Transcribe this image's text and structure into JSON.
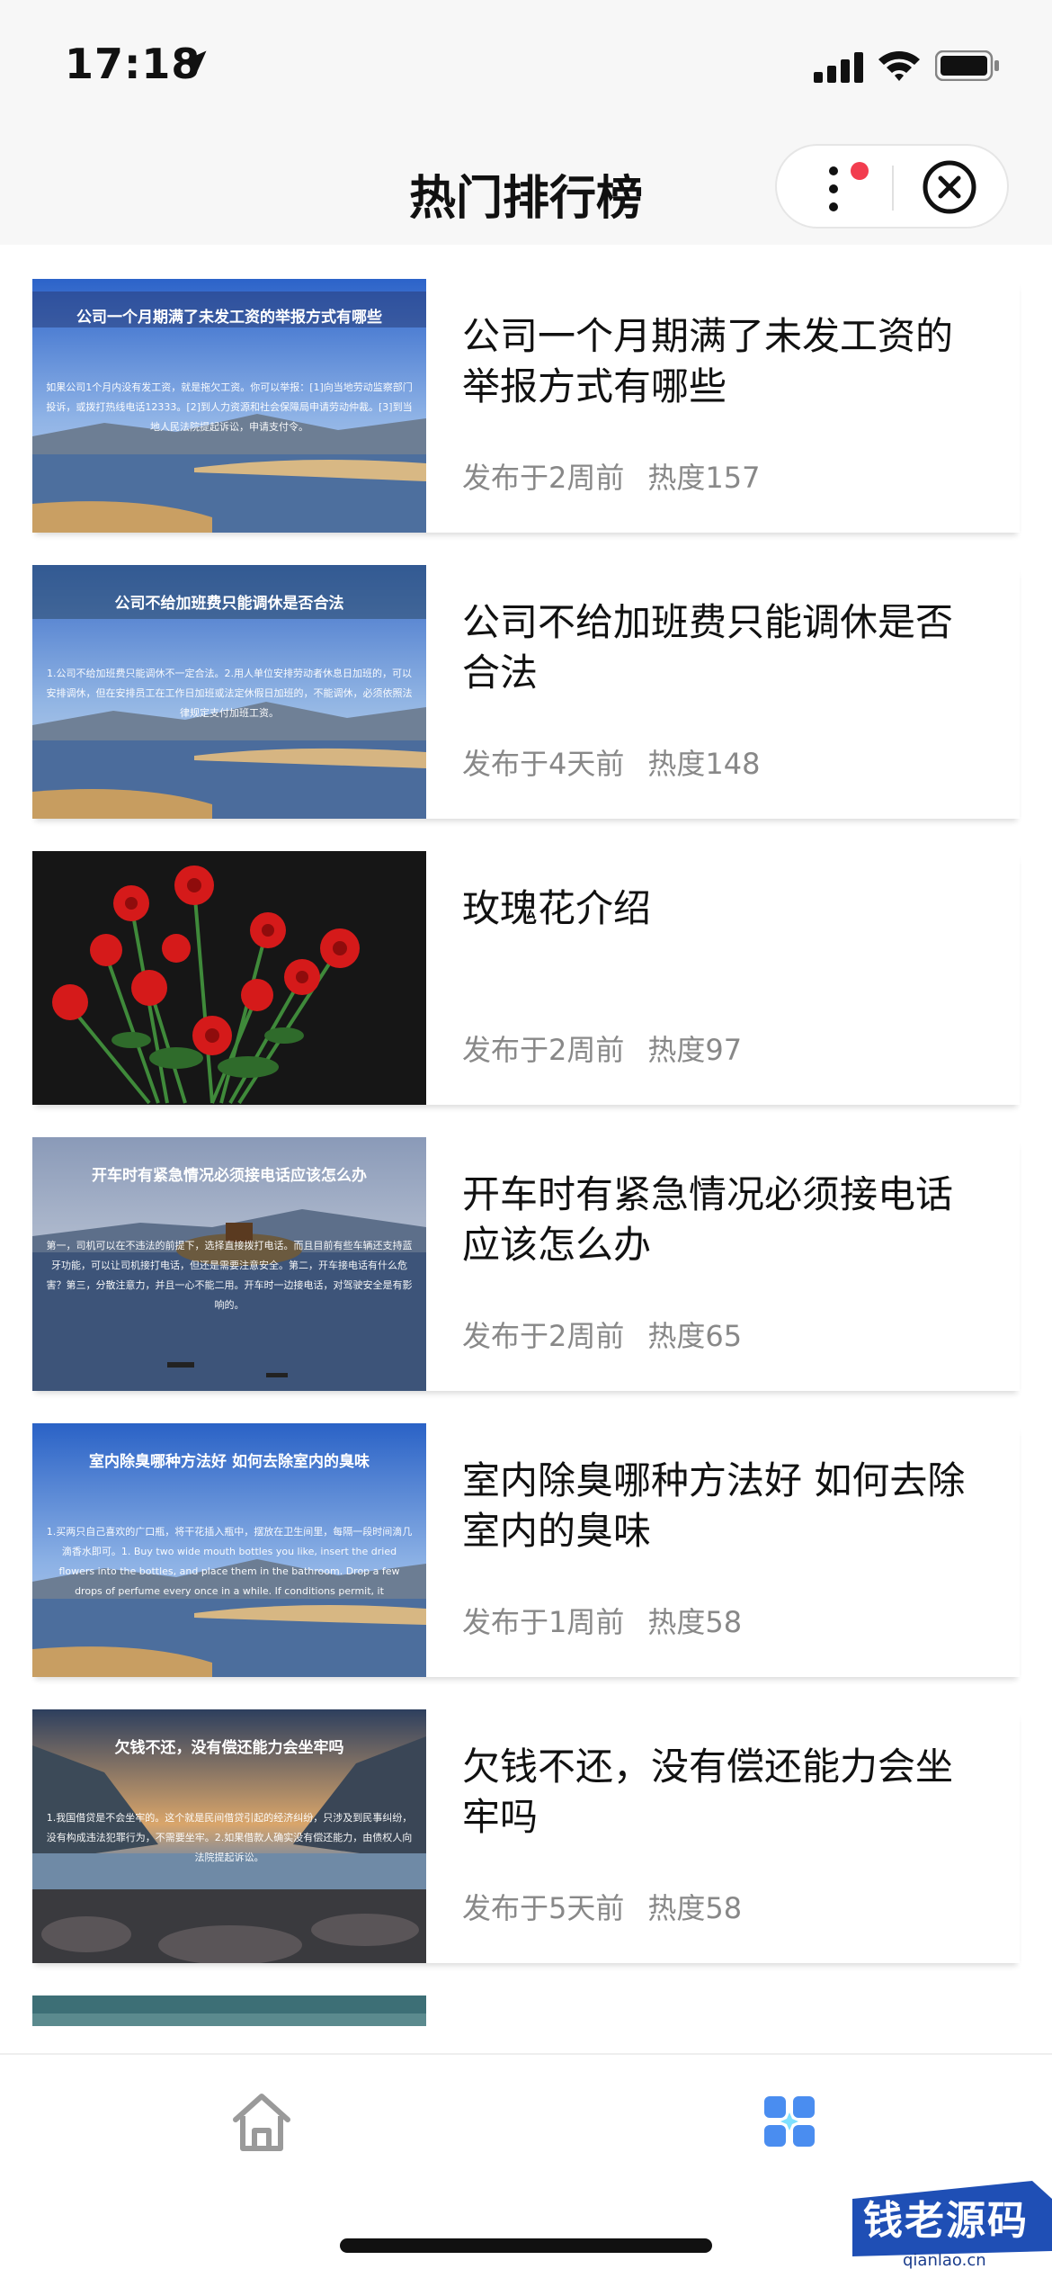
{
  "status_bar": {
    "time": "17:18"
  },
  "nav": {
    "title": "热门排行榜"
  },
  "items": [
    {
      "thumb_caption": "公司一个月期满了未发工资的举报方式有哪些",
      "thumb_body": "如果公司1个月内没有发工资，就是拖欠工资。你可以举报：[1]向当地劳动监察部门投诉，或拨打热线电话12333。[2]到人力资源和社会保障局申请劳动仲裁。[3]到当地人民法院提起诉讼，申请支付令。",
      "title": "公司一个月期满了未发工资的举报方式有哪些",
      "published": "发布于2周前",
      "heat": "热度157"
    },
    {
      "thumb_caption": "公司不给加班费只能调休是否合法",
      "thumb_body": "1.公司不给加班费只能调休不一定合法。2.用人单位安排劳动者休息日加班的，可以安排调休，但在安排员工在工作日加班或法定休假日加班的，不能调休，必须依照法律规定支付加班工资。",
      "title": "公司不给加班费只能调休是否合法",
      "published": "发布于4天前",
      "heat": "热度148"
    },
    {
      "thumb_caption": "",
      "thumb_body": "",
      "title": "玫瑰花介绍",
      "published": "发布于2周前",
      "heat": "热度97"
    },
    {
      "thumb_caption": "开车时有紧急情况必须接电话应该怎么办",
      "thumb_body": "第一，司机可以在不违法的前提下，选择直接拨打电话。而且目前有些车辆还支持蓝牙功能，可以让司机接打电话，但还是需要注意安全。第二，开车接电话有什么危害？第三，分散注意力，并且一心不能二用。开车时一边接电话，对驾驶安全是有影响的。",
      "title": "开车时有紧急情况必须接电话应该怎么办",
      "published": "发布于2周前",
      "heat": "热度65"
    },
    {
      "thumb_caption": "室内除臭哪种方法好 如何去除室内的臭味",
      "thumb_body": "1.买两只自己喜欢的广口瓶，将干花插入瓶中，摆放在卫生间里，每隔一段时间滴几滴香水即可。1. Buy two wide mouth bottles you like, insert the dried flowers into the bottles, and place them in the bathroom. Drop a few drops of perfume every once in a while. If conditions permit, it",
      "title": "室内除臭哪种方法好 如何去除室内的臭味",
      "published": "发布于1周前",
      "heat": "热度58"
    },
    {
      "thumb_caption": "欠钱不还，没有偿还能力会坐牢吗",
      "thumb_body": "1.我国借贷是不会坐牢的。这个就是民间借贷引起的经济纠纷，只涉及到民事纠纷，没有构成违法犯罪行为，不需要坐牢。2.如果借款人确实没有偿还能力，由债权人向法院提起诉讼。",
      "title": "欠钱不还，没有偿还能力会坐牢吗",
      "published": "发布于5天前",
      "heat": "热度58"
    }
  ],
  "watermark": {
    "text": "钱老源码",
    "sub": "qianlao.cn"
  },
  "colors": {
    "accent": "#3b82f6",
    "heart_red": "#f23d4f",
    "meta_gray": "#888888"
  }
}
